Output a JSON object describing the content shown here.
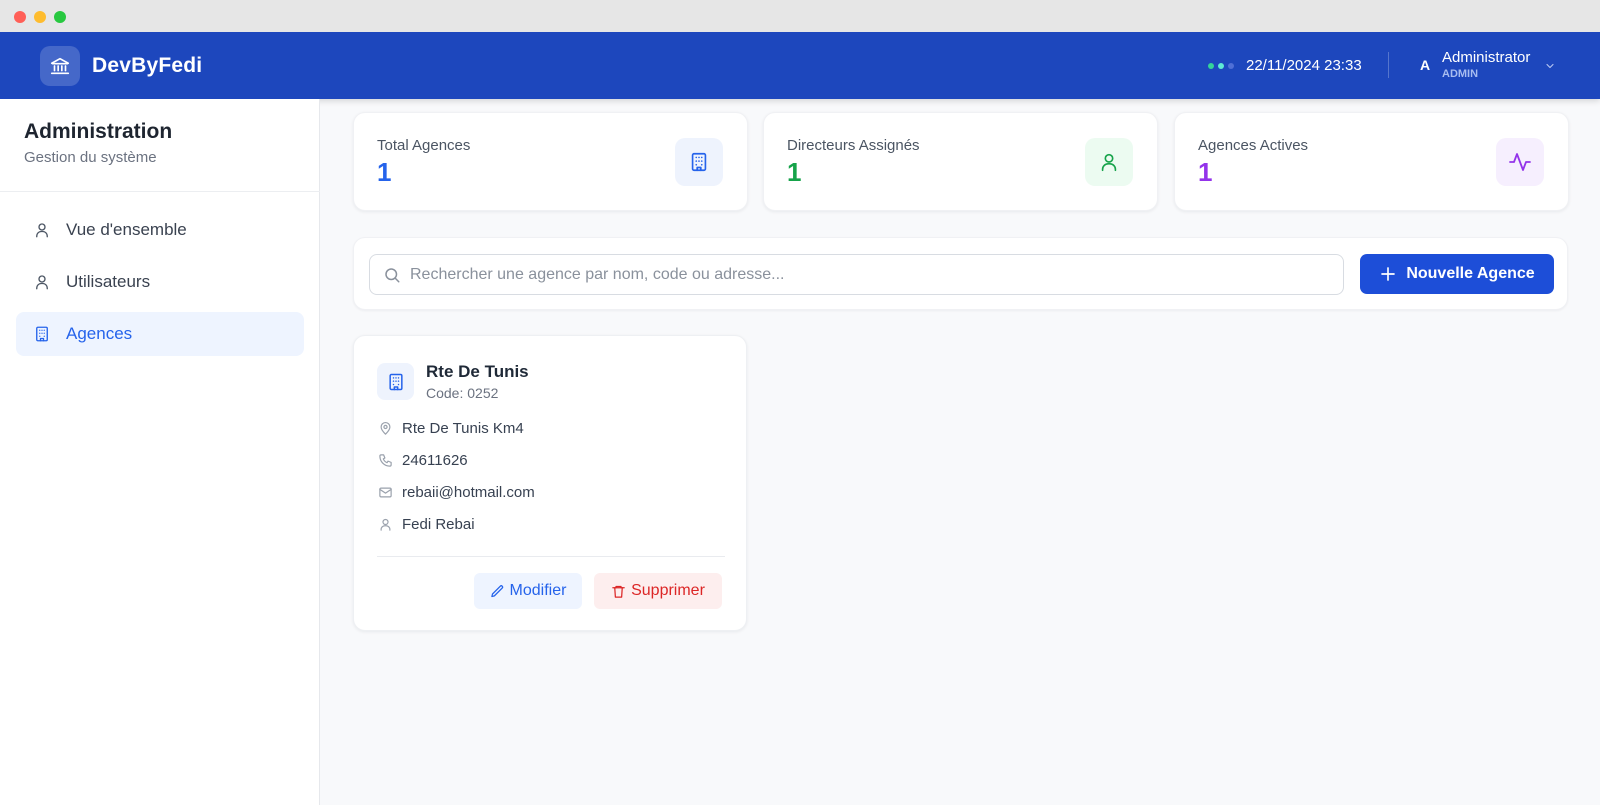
{
  "header": {
    "brand": "DevByFedi",
    "datetime": "22/11/2024 23:33",
    "user": {
      "initial": "A",
      "name": "Administrator",
      "role": "ADMIN"
    },
    "status_dot_colors": [
      "#34d399",
      "#5eead4",
      "#4f6fd6"
    ]
  },
  "sidebar": {
    "title": "Administration",
    "subtitle": "Gestion du système",
    "items": [
      {
        "label": "Vue d'ensemble",
        "icon": "user-icon",
        "active": false
      },
      {
        "label": "Utilisateurs",
        "icon": "user-icon",
        "active": false
      },
      {
        "label": "Agences",
        "icon": "building-icon",
        "active": true
      }
    ]
  },
  "stats": [
    {
      "label": "Total Agences",
      "value": "1",
      "color": "#2563eb",
      "icon": "building-icon"
    },
    {
      "label": "Directeurs Assignés",
      "value": "1",
      "color": "#16a34a",
      "icon": "user-icon"
    },
    {
      "label": "Agences Actives",
      "value": "1",
      "color": "#9333ea",
      "icon": "activity-icon"
    }
  ],
  "search": {
    "placeholder": "Rechercher une agence par nom, code ou adresse...",
    "new_button_label": "Nouvelle Agence"
  },
  "agencies": [
    {
      "name": "Rte De Tunis",
      "code": "Code: 0252",
      "address": "Rte De Tunis Km4",
      "phone": "24611626",
      "email": "rebaii@hotmail.com",
      "director": "Fedi Rebai",
      "edit_label": "Modifier",
      "delete_label": "Supprimer"
    }
  ],
  "colors": {
    "header_bg": "#1d47bd",
    "accent": "#2563eb",
    "danger": "#dc2626"
  }
}
